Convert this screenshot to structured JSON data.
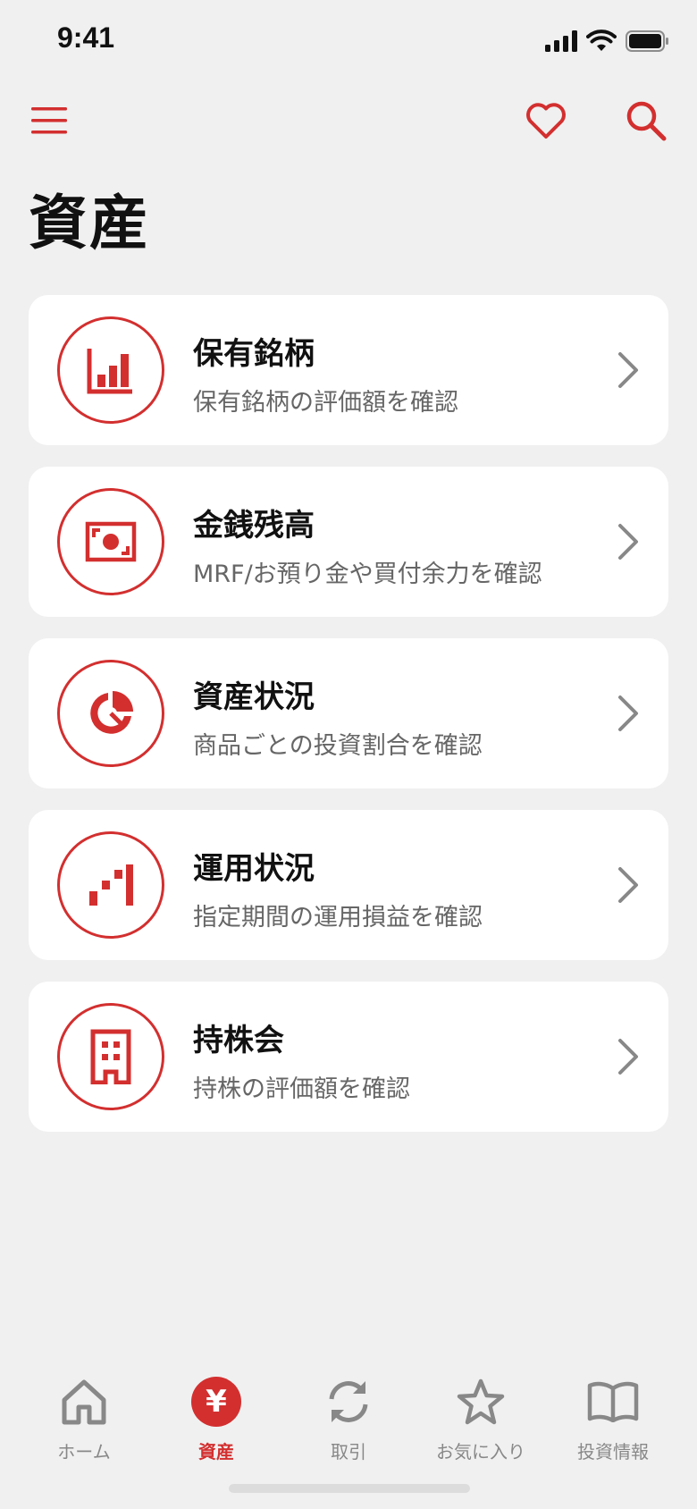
{
  "status_bar": {
    "time": "9:41"
  },
  "header": {
    "title": "資産"
  },
  "accent_color": "#d32f2f",
  "menu_items": [
    {
      "icon": "bar-chart-icon",
      "title": "保有銘柄",
      "subtitle": "保有銘柄の評価額を確認"
    },
    {
      "icon": "cash-icon",
      "title": "金銭残高",
      "subtitle": "MRF/お預り金や買付余力を確認"
    },
    {
      "icon": "pie-chart-icon",
      "title": "資産状況",
      "subtitle": "商品ごとの投資割合を確認"
    },
    {
      "icon": "performance-bars-icon",
      "title": "運用状況",
      "subtitle": "指定期間の運用損益を確認"
    },
    {
      "icon": "building-icon",
      "title": "持株会",
      "subtitle": "持株の評価額を確認"
    }
  ],
  "tabs": [
    {
      "icon": "home-icon",
      "label": "ホーム",
      "active": false
    },
    {
      "icon": "yen-icon",
      "icon_glyph": "¥",
      "label": "資産",
      "active": true
    },
    {
      "icon": "refresh-icon",
      "label": "取引",
      "active": false
    },
    {
      "icon": "star-icon",
      "label": "お気に入り",
      "active": false
    },
    {
      "icon": "book-icon",
      "label": "投資情報",
      "active": false
    }
  ]
}
